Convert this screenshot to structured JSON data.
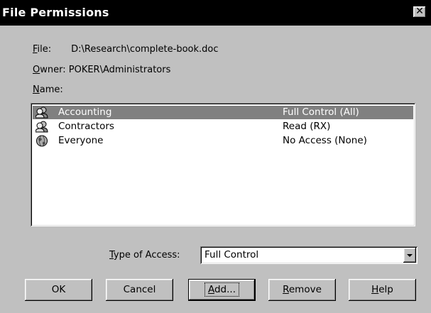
{
  "window": {
    "title": "File Permissions",
    "close_glyph": "✕"
  },
  "info": {
    "file_label": "File:",
    "file_value": "D:\\Research\\complete-book.doc",
    "owner_label": "Owner:",
    "owner_value": "POKER\\Administrators",
    "name_label": "Name:"
  },
  "entries": [
    {
      "name": "Accounting",
      "access": "Full Control (All)",
      "icon": "group-icon",
      "selected": true
    },
    {
      "name": "Contractors",
      "access": "Read (RX)",
      "icon": "group-icon",
      "selected": false
    },
    {
      "name": "Everyone",
      "access": "No Access (None)",
      "icon": "globe-icon",
      "selected": false
    }
  ],
  "type_of_access": {
    "label": "Type of Access:",
    "value": "Full Control"
  },
  "buttons": {
    "ok": "OK",
    "cancel": "Cancel",
    "add": "Add...",
    "remove": "Remove",
    "help": "Help"
  },
  "colors": {
    "face": "#c0c0c0",
    "selection": "#808080",
    "titlebar": "#000000"
  }
}
